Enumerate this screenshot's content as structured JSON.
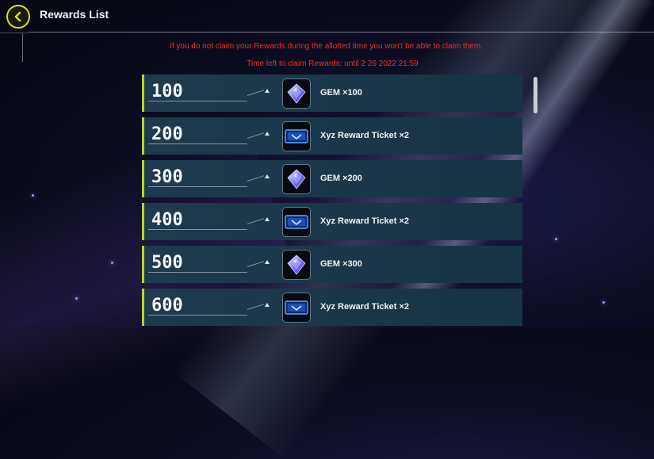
{
  "header": {
    "title": "Rewards List",
    "back_icon": "chevron-left-icon"
  },
  "notice": {
    "warning": "If you do not claim your Rewards during the allotted time you won't be able to claim them.",
    "deadline": "Time left to claim Rewards: until 2 26 2022 21:59"
  },
  "colors": {
    "accent": "#d9e21c",
    "warning": "#e8322a",
    "row_bg": "#1e3a4e",
    "row_edge": "#b7d620"
  },
  "rewards": [
    {
      "count": "100",
      "icon": "gem-icon",
      "label": "GEM ×100"
    },
    {
      "count": "200",
      "icon": "ticket-icon",
      "label": "Xyz Reward Ticket ×2"
    },
    {
      "count": "300",
      "icon": "gem-icon",
      "label": "GEM ×200"
    },
    {
      "count": "400",
      "icon": "ticket-icon",
      "label": "Xyz Reward Ticket ×2"
    },
    {
      "count": "500",
      "icon": "gem-icon",
      "label": "GEM ×300"
    },
    {
      "count": "600",
      "icon": "ticket-icon",
      "label": "Xyz Reward Ticket ×2"
    }
  ]
}
